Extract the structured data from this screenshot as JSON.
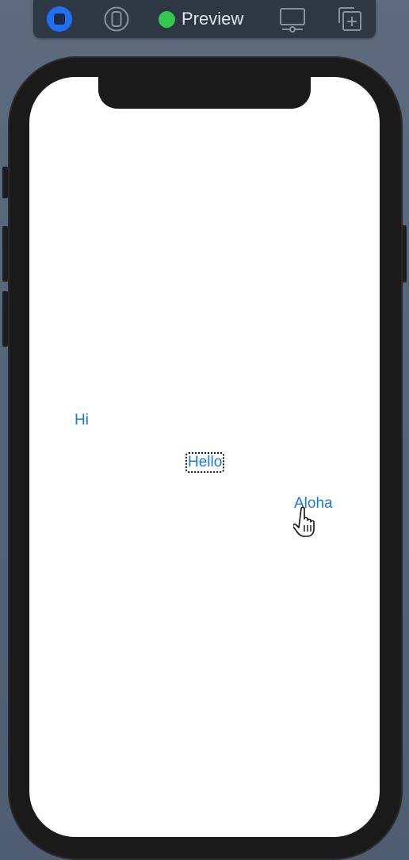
{
  "toolbar": {
    "live_button": "live-preview-stop-icon",
    "device_button": "device-selector-icon",
    "status_label": "Preview",
    "status_color": "#32c74e",
    "display_button": "device-settings-icon",
    "duplicate_button": "duplicate-preview-icon"
  },
  "screen": {
    "labels": {
      "hi": "Hi",
      "hello": "Hello",
      "aloha": "Aloha"
    },
    "text_color": "#1b7ad6",
    "focused_item": "Hello"
  },
  "cursor": "pointing-hand-cursor-icon"
}
